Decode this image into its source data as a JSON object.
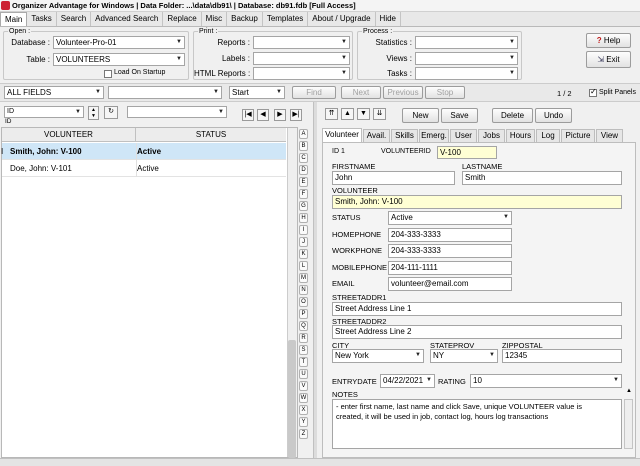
{
  "title": "Organizer Advantage for Windows | Data Folder: ...\\data\\db91\\ | Database: db91.fdb [Full Access]",
  "menu": [
    "Main",
    "Tasks",
    "Search",
    "Advanced Search",
    "Replace",
    "Misc",
    "Backup",
    "Templates",
    "About / Upgrade",
    "Hide"
  ],
  "open": {
    "legend": "Open :",
    "database_label": "Database :",
    "database_value": "Volunteer-Pro-01",
    "table_label": "Table :",
    "table_value": "VOLUNTEERS",
    "load_on_startup": "Load On Startup"
  },
  "print": {
    "legend": "Print :",
    "reports": "Reports :",
    "labels": "Labels :",
    "html_reports": "HTML Reports :"
  },
  "process": {
    "legend": "Process :",
    "statistics": "Statistics :",
    "views": "Views :",
    "tasks": "Tasks :"
  },
  "help_label": "Help",
  "exit_label": "Exit",
  "search": {
    "field": "ALL FIELDS",
    "mode": "Start",
    "find": "Find",
    "next": "Next",
    "previous": "Previous",
    "stop": "Stop",
    "page": "1 / 2",
    "split_panels": "Split Panels"
  },
  "sort": {
    "field": "ID",
    "sub": "ID"
  },
  "grid": {
    "columns": [
      "VOLUNTEER",
      "STATUS"
    ],
    "marker": "I",
    "rows": [
      {
        "volunteer": "Smith, John: V-100",
        "status": "Active"
      },
      {
        "volunteer": "Doe, John: V-101",
        "status": "Active"
      }
    ]
  },
  "alphabet": [
    "A",
    "B",
    "C",
    "D",
    "E",
    "F",
    "G",
    "H",
    "I",
    "J",
    "K",
    "L",
    "M",
    "N",
    "O",
    "P",
    "Q",
    "R",
    "S",
    "T",
    "U",
    "V",
    "W",
    "X",
    "Y",
    "Z"
  ],
  "record_buttons": {
    "new": "New",
    "save": "Save",
    "delete": "Delete",
    "undo": "Undo"
  },
  "tabs": [
    "Volunteer",
    "Avail.",
    "Skills",
    "Emerg.",
    "User",
    "Jobs",
    "Hours",
    "Log",
    "Picture",
    "View"
  ],
  "form": {
    "id_label": "ID 1",
    "volunteerid_label": "VOLUNTEERID",
    "volunteerid": "V-100",
    "firstname_label": "FIRSTNAME",
    "firstname": "John",
    "lastname_label": "LASTNAME",
    "lastname": "Smith",
    "volunteer_label": "VOLUNTEER",
    "volunteer": "Smith, John: V-100",
    "status_label": "STATUS",
    "status": "Active",
    "homephone_label": "HOMEPHONE",
    "homephone": "204-333-3333",
    "workphone_label": "WORKPHONE",
    "workphone": "204-333-3333",
    "mobilephone_label": "MOBILEPHONE",
    "mobilephone": "204-111-1111",
    "email_label": "EMAIL",
    "email": "volunteer@email.com",
    "street1_label": "STREETADDR1",
    "street1": "Street Address Line 1",
    "street2_label": "STREETADDR2",
    "street2": "Street Address Line 2",
    "city_label": "CITY",
    "city": "New York",
    "state_label": "STATEPROV",
    "state": "NY",
    "zip_label": "ZIPPOSTAL",
    "zip": "12345",
    "entrydate_label": "ENTRYDATE",
    "entrydate": "04/22/2021",
    "rating_label": "RATING",
    "rating": "10",
    "notes_label": "NOTES",
    "notes_line1": "- enter first name, last name and click Save, unique VOLUNTEER value is",
    "notes_line2": "created, it will be used in job, contact log, hours log transactions"
  },
  "colors": {
    "selected_row": "#cfe6f7",
    "yellow_field": "#ffffd4",
    "label_blue": "#1e3c8c"
  }
}
